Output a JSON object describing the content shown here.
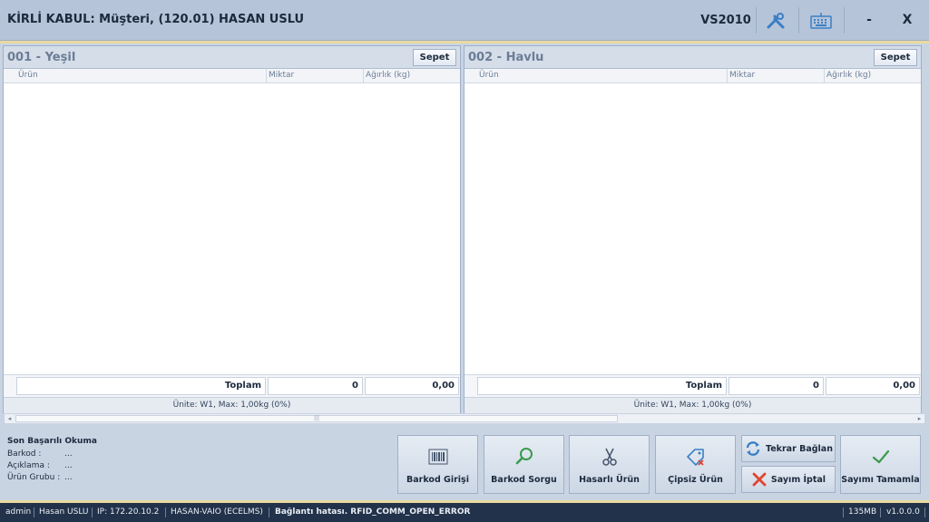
{
  "window": {
    "title": "KİRLİ KABUL: Müşteri, (120.01) HASAN USLU",
    "code": "VS2010",
    "minimize_label": "-",
    "close_label": "X",
    "icons": [
      "tools-icon",
      "keyboard-icon"
    ]
  },
  "panels": [
    {
      "title": "001 - Yeşil",
      "sepet_label": "Sepet",
      "columns": [
        "Ürün",
        "Miktar",
        "Ağırlık (kg)"
      ],
      "total_label": "Toplam",
      "total_qty": "0",
      "total_weight": "0,00",
      "unit_info": "Ünite: W1, Max: 1,00kg (0%)"
    },
    {
      "title": "002 - Havlu",
      "sepet_label": "Sepet",
      "columns": [
        "Ürün",
        "Miktar",
        "Ağırlık (kg)"
      ],
      "total_label": "Toplam",
      "total_qty": "0",
      "total_weight": "0,00",
      "unit_info": "Ünite: W1, Max: 1,00kg (0%)"
    }
  ],
  "last_read": {
    "title": "Son Başarılı Okuma",
    "rows": [
      {
        "label": "Barkod :",
        "value": "..."
      },
      {
        "label": "Açıklama :",
        "value": "..."
      },
      {
        "label": "Ürün Grubu :",
        "value": "..."
      }
    ]
  },
  "buttons": {
    "barkod_girisi": "Barkod Girişi",
    "barkod_sorgu": "Barkod Sorgu",
    "hasarli_urun": "Hasarlı Ürün",
    "cipsiz_urun": "Çipsiz Ürün",
    "tekrar_baglan": "Tekrar Bağlan",
    "sayim_iptal": "Sayım İptal",
    "sayimi_tamamla": "Sayımı Tamamla"
  },
  "colors": {
    "accent": "#ead9a0",
    "status_bg": "#22324a",
    "check_green": "#3a9a4a",
    "cancel_red": "#e0452f",
    "icon_blue": "#3a7fc4"
  },
  "status": {
    "user": "admin",
    "name": "Hasan USLU",
    "ip": "IP: 172.20.10.2",
    "host": "HASAN-VAIO (ECELMS)",
    "error": "Bağlantı hatası. RFID_COMM_OPEN_ERROR",
    "memory": "135MB",
    "version": "v1.0.0.0"
  }
}
